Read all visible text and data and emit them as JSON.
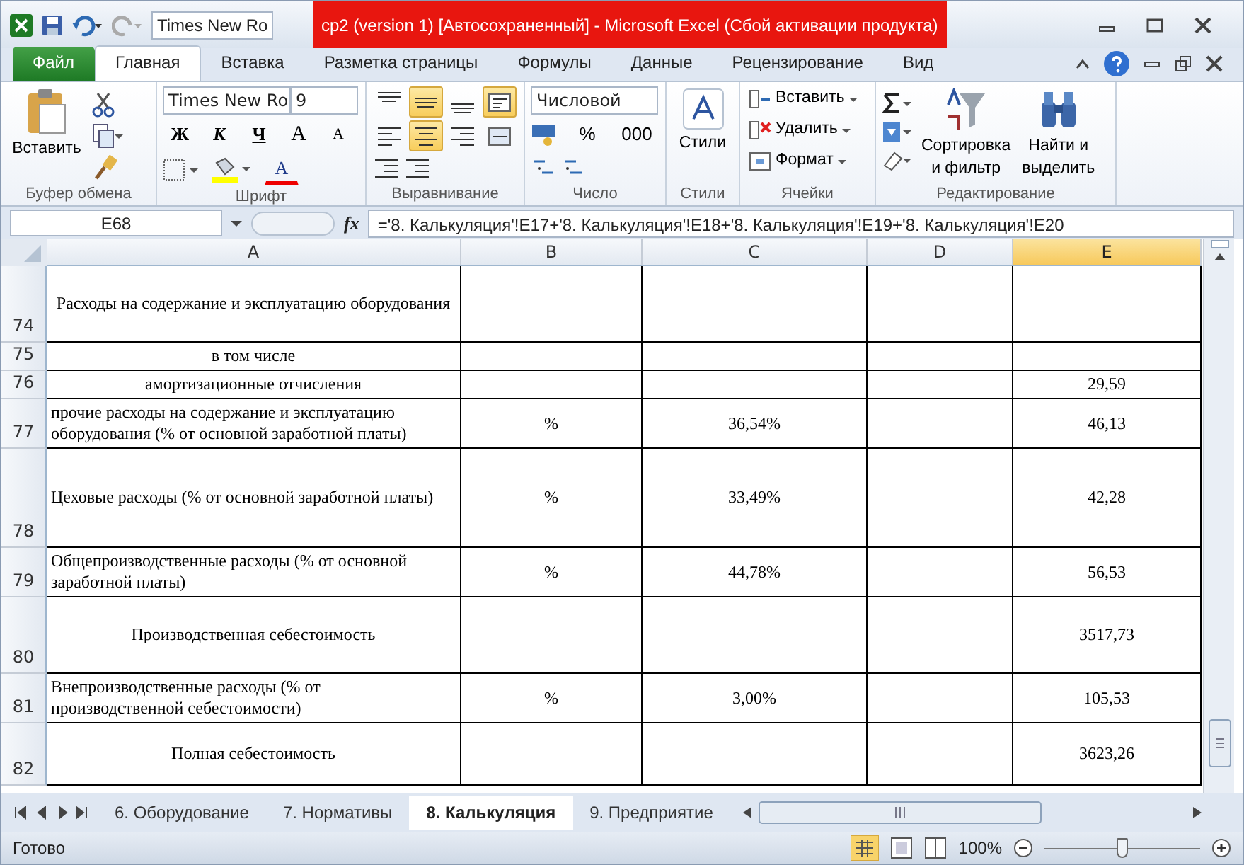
{
  "window": {
    "title": "ср2 (version 1) [Автосохраненный]  -  Microsoft Excel (Сбой активации продукта)",
    "qat_font": "Times New Ro"
  },
  "ribbon_tabs": [
    {
      "label": "Файл",
      "kind": "file",
      "selected": false
    },
    {
      "label": "Главная",
      "kind": "tab",
      "selected": true
    },
    {
      "label": "Вставка",
      "kind": "tab",
      "selected": false
    },
    {
      "label": "Разметка страницы",
      "kind": "tab",
      "selected": false
    },
    {
      "label": "Формулы",
      "kind": "tab",
      "selected": false
    },
    {
      "label": "Данные",
      "kind": "tab",
      "selected": false
    },
    {
      "label": "Рецензирование",
      "kind": "tab",
      "selected": false
    },
    {
      "label": "Вид",
      "kind": "tab",
      "selected": false
    }
  ],
  "ribbon": {
    "clipboard": {
      "label": "Буфер обмена",
      "paste": "Вставить"
    },
    "font": {
      "label": "Шрифт",
      "name": "Times New Ro",
      "size": "9",
      "bold": "Ж",
      "italic": "К",
      "underline": "Ч",
      "grow": "A",
      "shrink": "A",
      "font_color_letter": "A"
    },
    "alignment": {
      "label": "Выравнивание",
      "buttons": [
        {
          "kind": "top",
          "selected": false
        },
        {
          "kind": "middle",
          "selected": true
        },
        {
          "kind": "bottom",
          "selected": false
        },
        {
          "kind": "wrap",
          "selected": true
        },
        {
          "kind": "left",
          "selected": false
        },
        {
          "kind": "center",
          "selected": true
        },
        {
          "kind": "right",
          "selected": false
        },
        {
          "kind": "merge",
          "selected": false
        }
      ]
    },
    "number": {
      "label": "Число",
      "format": "Числовой",
      "percent": "%",
      "thousands": "000"
    },
    "styles": {
      "label": "Стили",
      "button": "Стили"
    },
    "cells": {
      "label": "Ячейки",
      "buttons": [
        "Вставить",
        "Удалить",
        "Формат"
      ]
    },
    "editing": {
      "label": "Редактирование",
      "sort": "Сортировка",
      "sort2": "и фильтр",
      "find": "Найти и",
      "find2": "выделить"
    }
  },
  "formula_bar": {
    "name_box": "E68",
    "fx": "fx",
    "formula": "='8. Калькуляция'!E17+'8. Калькуляция'!E18+'8. Калькуляция'!E19+'8. Калькуляция'!E20"
  },
  "columns": [
    {
      "label": "A",
      "selected": false
    },
    {
      "label": "B",
      "selected": false
    },
    {
      "label": "C",
      "selected": false
    },
    {
      "label": "D",
      "selected": false
    },
    {
      "label": "E",
      "selected": true
    }
  ],
  "rows": [
    {
      "number": "74",
      "kind": "center",
      "a": "Расходы на содержание и эксплуатацию оборудования"
    },
    {
      "number": "75",
      "kind": "center",
      "a": "в том числе"
    },
    {
      "number": "76",
      "kind": "center",
      "a": "амортизационные отчисления",
      "e": "29,59"
    },
    {
      "number": "77",
      "kind": "left",
      "a": "прочие расходы на содержание и эксплуатацию оборудования (% от основной заработной платы)",
      "b": "%",
      "c": "36,54%",
      "e": "46,13"
    },
    {
      "number": "78",
      "kind": "left",
      "a": "Цеховые расходы (% от основной заработной платы)",
      "b": "%",
      "c": "33,49%",
      "e": "42,28"
    },
    {
      "number": "79",
      "kind": "left",
      "a": "Общепроизводственные расходы (% от основной заработной платы)",
      "b": "%",
      "c": "44,78%",
      "e": "56,53"
    },
    {
      "number": "80",
      "kind": "center",
      "a": "Производственная себестоимость",
      "e": "3517,73"
    },
    {
      "number": "81",
      "kind": "left",
      "a": "Внепроизводственные расходы (% от производственной себестоимости)",
      "b": "%",
      "c": "3,00%",
      "e": "105,53"
    },
    {
      "number": "82",
      "kind": "center",
      "a": "Полная себестоимость",
      "e": "3623,26"
    }
  ],
  "sheet_tabs": [
    {
      "label": "6. Оборудование",
      "selected": false
    },
    {
      "label": "7. Нормативы",
      "selected": false
    },
    {
      "label": "8. Калькуляция",
      "selected": true
    },
    {
      "label": "9. Предприятие",
      "selected": false
    }
  ],
  "status_bar": {
    "status": "Готово",
    "zoom": "100%",
    "level": 0.5
  }
}
